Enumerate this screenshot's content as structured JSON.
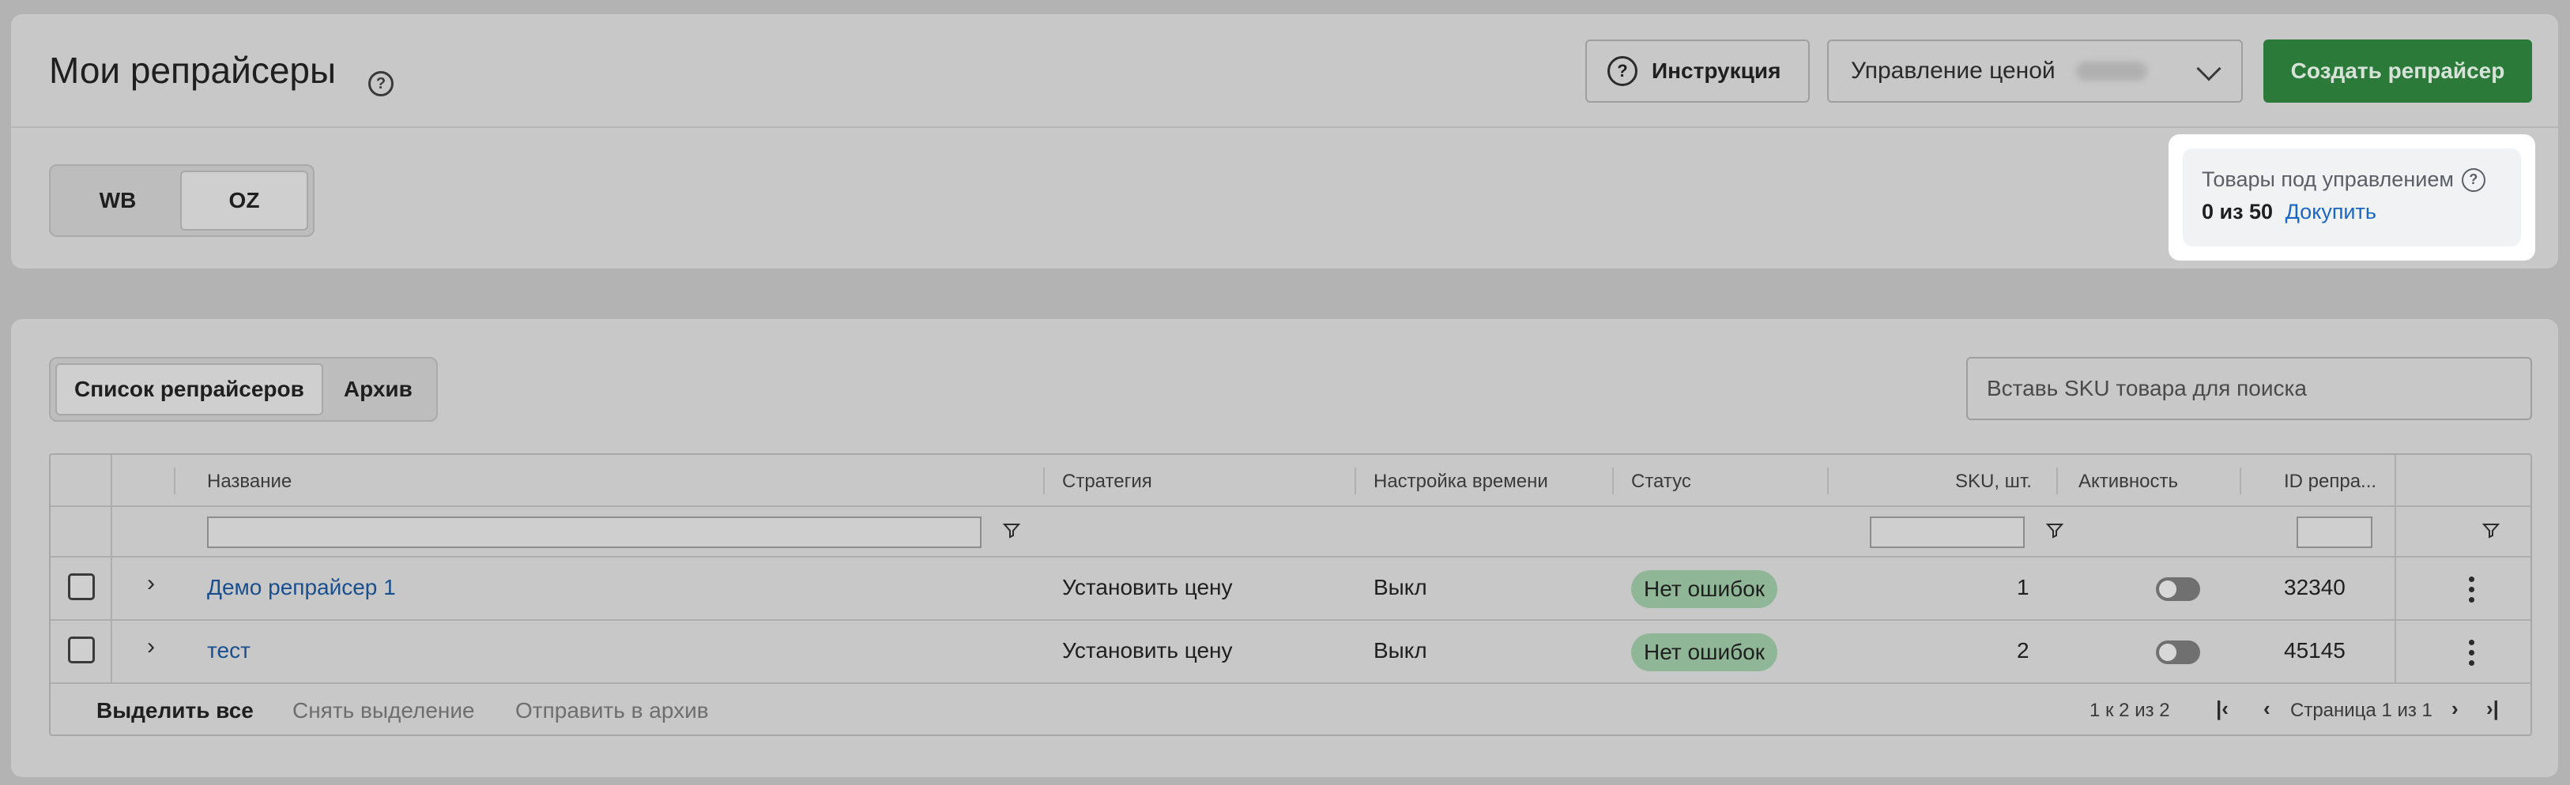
{
  "header": {
    "title": "Мои репрайсеры",
    "instruction_label": "Инструкция",
    "price_select_label": "Управление ценой",
    "create_label": "Создать репрайсер"
  },
  "marketplace_toggle": {
    "options": [
      "WB",
      "OZ"
    ],
    "selected": "OZ"
  },
  "quota": {
    "title": "Товары под управлением",
    "count": "0 из 50",
    "buy_link": "Докупить"
  },
  "tabs": {
    "items": [
      "Список репрайсеров",
      "Архив"
    ],
    "selected": "Список репрайсеров"
  },
  "search": {
    "placeholder": "Вставь SKU товара для поиска"
  },
  "table": {
    "columns": [
      "Название",
      "Стратегия",
      "Настройка времени",
      "Статус",
      "SKU, шт.",
      "Активность",
      "ID репра..."
    ],
    "rows": [
      {
        "name": "Демо репрайсер 1",
        "strategy": "Установить цену",
        "time": "Выкл",
        "status": "Нет ошибок",
        "sku": "1",
        "active": false,
        "id": "32340"
      },
      {
        "name": "тест",
        "strategy": "Установить цену",
        "time": "Выкл",
        "status": "Нет ошибок",
        "sku": "2",
        "active": false,
        "id": "45145"
      }
    ]
  },
  "footer": {
    "select_all": "Выделить все",
    "deselect": "Снять выделение",
    "archive": "Отправить в архив",
    "range": "1 к 2 из 2",
    "page": "Страница 1 из 1"
  },
  "colors": {
    "primary_green": "#2b7a3a",
    "link_blue": "#1a66c4",
    "status_green": "#8fb797"
  },
  "icons": [
    "help-circle-icon",
    "chevron-down-icon",
    "filter-icon",
    "chevron-right-icon",
    "kebab-menu-icon",
    "first-page-icon",
    "prev-page-icon",
    "next-page-icon",
    "last-page-icon"
  ]
}
